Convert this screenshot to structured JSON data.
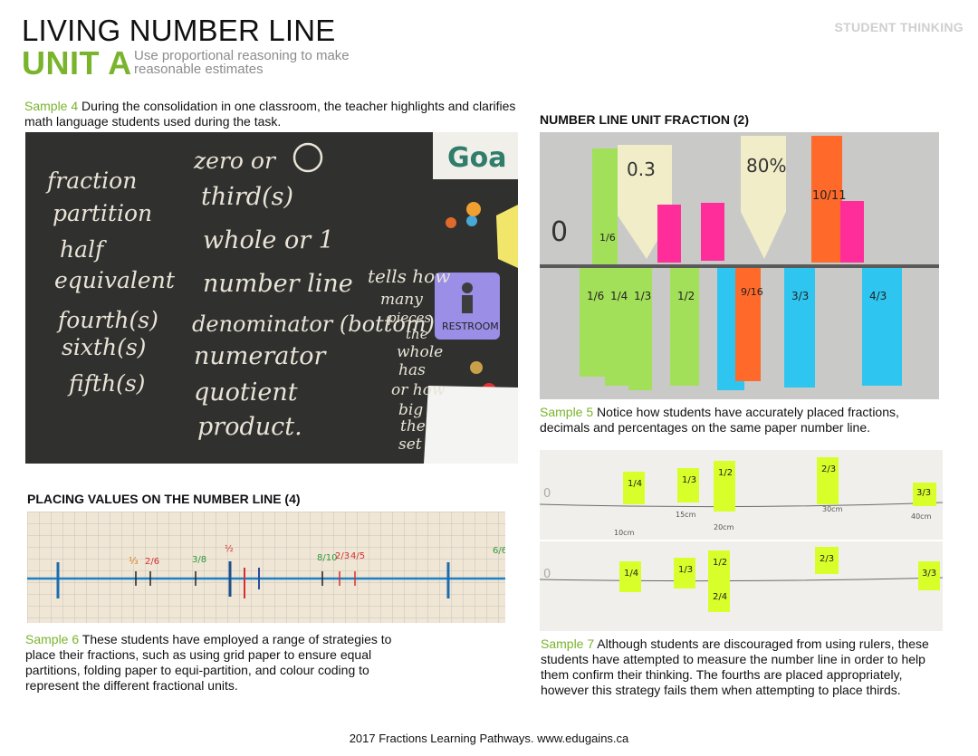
{
  "header": {
    "title": "LIVING NUMBER LINE",
    "unit": "UNIT A",
    "subtitle": "Use proportional reasoning to make reasonable estimates",
    "tag": "STUDENT THINKING"
  },
  "sample4": {
    "label": "Sample 4",
    "text": " During the consolidation in one classroom, the teacher highlights and clarifies math language students used during the task.",
    "chalk_col1": [
      "fraction",
      "partition",
      "half",
      "equivalent",
      "fourth(s)",
      "sixth(s)",
      "fifth(s)"
    ],
    "chalk_col2": [
      "zero or",
      "third(s)",
      "whole or 1",
      "number line",
      "denominator (bottom)",
      "numerator",
      "quotient",
      "product."
    ],
    "chalk_side": [
      "tells how",
      "many",
      "pieces",
      "the",
      "whole",
      "has",
      "or how",
      "big",
      "the",
      "set"
    ],
    "sign_text": "RESTROOM",
    "goal_text": "Goa"
  },
  "section_placing": {
    "heading": "PLACING VALUES ON THE NUMBER LINE (4)"
  },
  "sample6": {
    "label": "Sample 6",
    "text": "  These students have employed a range of strategies to place their fractions, such as using grid paper to ensure equal partitions, folding paper to equi-partition, and colour coding to represent the different fractional units."
  },
  "section_unit_fraction": {
    "heading": "NUMBER LINE UNIT FRACTION (2)"
  },
  "sample5": {
    "label": "Sample 5",
    "text": "  Notice how students have accurately placed fractions, decimals and percentages on the same paper number line.",
    "top_cards": [
      "0.3",
      "80%",
      "10/11"
    ]
  },
  "sample7": {
    "label": "Sample 7",
    "text": "  Although students are discouraged from using rulers, these students have attempted to measure the number line in order to help them confirm their thinking. The fourths are placed appropriately, however this strategy fails them when attempting to place thirds.",
    "cm_marks": [
      "10cm",
      "15cm",
      "20cm",
      "30cm",
      "40cm"
    ],
    "fractions_top": [
      "1/4",
      "1/3",
      "1/2",
      "2/3",
      "3/3"
    ],
    "fractions_bottom": [
      "1/4",
      "1/3",
      "1/2",
      "2/4",
      "2/3",
      "3/3"
    ]
  },
  "footer": {
    "text": "2017 Fractions Learning Pathways. www.edugains.ca"
  },
  "colors": {
    "accent": "#7ab42c",
    "tag": "#cfcfcf",
    "chalkboard": "#2b2b2b",
    "sticky_green": "#a3e05a",
    "sticky_pink": "#ff2d9a",
    "sticky_orange": "#ff6a2a",
    "sticky_cyan": "#2ec6f0",
    "sticky_yellow": "#d8ff2a"
  }
}
